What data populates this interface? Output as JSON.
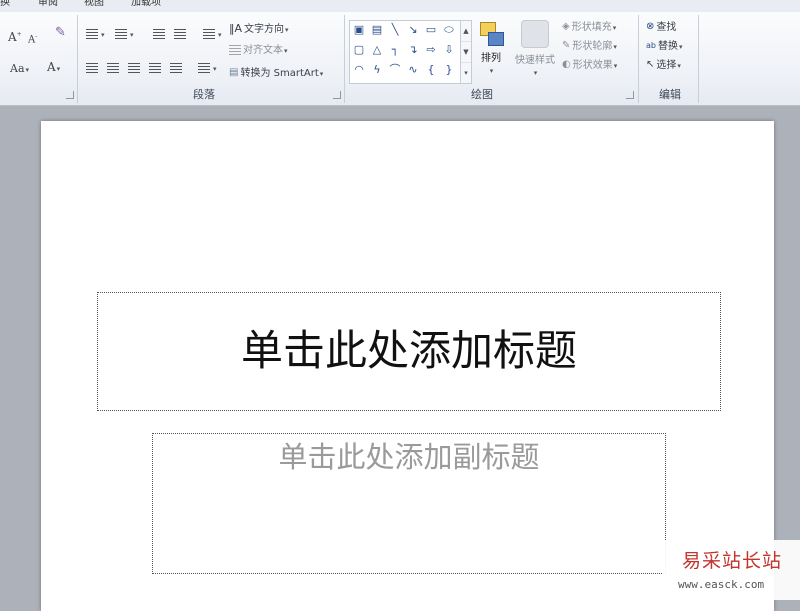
{
  "menu_tabs": [
    "视图",
    "审阅",
    "视图",
    "加载项"
  ],
  "tabs_visible": {
    "t1": "换",
    "t2": "审阅",
    "t3": "视图",
    "t4": "加载项"
  },
  "font_group": {
    "grow": "A",
    "shrink": "A",
    "case": "Aa",
    "color": "A"
  },
  "paragraph": {
    "label": "段落",
    "text_direction": "文字方向",
    "align_text": "对齐文本",
    "convert_smartart": "转换为 SmartArt"
  },
  "drawing": {
    "label": "绘图",
    "arrange": "排列",
    "quick_styles": "快速样式",
    "shape_fill": "形状填充",
    "shape_outline": "形状轮廓",
    "shape_effects": "形状效果"
  },
  "editing": {
    "label": "编辑",
    "find": "查找",
    "replace": "替换",
    "select": "选择"
  },
  "slide": {
    "title_placeholder": "单击此处添加标题",
    "subtitle_placeholder": "单击此处添加副标题"
  },
  "watermark": {
    "name": "易采站长站",
    "url": "www.easck.com"
  }
}
